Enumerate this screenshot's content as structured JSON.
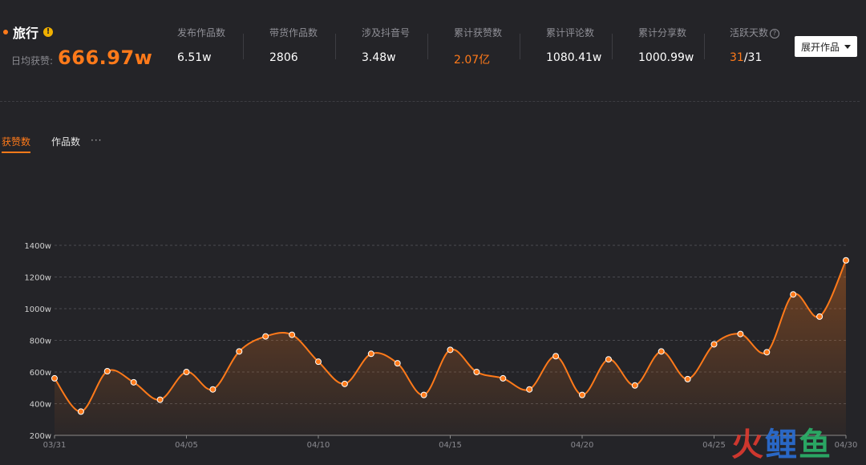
{
  "topic": {
    "title": "旅行",
    "info_icon": "info-icon"
  },
  "daily_avg": {
    "label": "日均获赞:",
    "value": "666.97w"
  },
  "stats": [
    {
      "label": "发布作品数",
      "value": "6.51w"
    },
    {
      "label": "带货作品数",
      "value": "2806"
    },
    {
      "label": "涉及抖音号",
      "value": "3.48w"
    },
    {
      "label": "累计获赞数",
      "value": "2.07亿",
      "highlight": true
    },
    {
      "label": "累计评论数",
      "value": "1080.41w"
    },
    {
      "label": "累计分享数",
      "value": "1000.99w"
    },
    {
      "label": "活跃天数",
      "value_active": "31",
      "value_total": "/31",
      "help_icon": "question-icon"
    }
  ],
  "expand_button": {
    "label": "展开作品"
  },
  "tabs": [
    {
      "label": "获赞数",
      "active": true
    },
    {
      "label": "作品数",
      "active": false
    },
    {
      "label": "···"
    }
  ],
  "colors": {
    "accent": "#ff7a1a",
    "background": "#242428"
  },
  "watermark": {
    "chars": [
      "火",
      "鲤",
      "鱼"
    ]
  },
  "chart_data": {
    "type": "area",
    "y_tick_labels": [
      "200w",
      "400w",
      "600w",
      "800w",
      "1000w",
      "1200w",
      "1400w"
    ],
    "y_ticks": [
      200,
      400,
      600,
      800,
      1000,
      1200,
      1400
    ],
    "ylim": [
      200,
      1400
    ],
    "x_tick_labels": [
      "03/31",
      "04/05",
      "04/10",
      "04/15",
      "04/20",
      "04/25",
      "04/30"
    ],
    "x_tick_index": [
      0,
      5,
      10,
      15,
      20,
      25,
      30
    ],
    "x": [
      "03/31",
      "04/01",
      "04/02",
      "04/03",
      "04/04",
      "04/05",
      "04/06",
      "04/07",
      "04/08",
      "04/09",
      "04/10",
      "04/11",
      "04/12",
      "04/13",
      "04/14",
      "04/15",
      "04/16",
      "04/17",
      "04/18",
      "04/19",
      "04/20",
      "04/21",
      "04/22",
      "04/23",
      "04/24",
      "04/25",
      "04/26",
      "04/27",
      "04/28",
      "04/29",
      "04/30"
    ],
    "series": [
      {
        "values": [
          560,
          350,
          605,
          535,
          425,
          600,
          490,
          730,
          825,
          835,
          665,
          525,
          715,
          655,
          455,
          740,
          600,
          560,
          490,
          700,
          455,
          680,
          515,
          730,
          555,
          775,
          840,
          725,
          1090,
          950,
          1305
        ]
      }
    ],
    "grid": true,
    "color": "#ff7a1a",
    "unit": "w"
  }
}
